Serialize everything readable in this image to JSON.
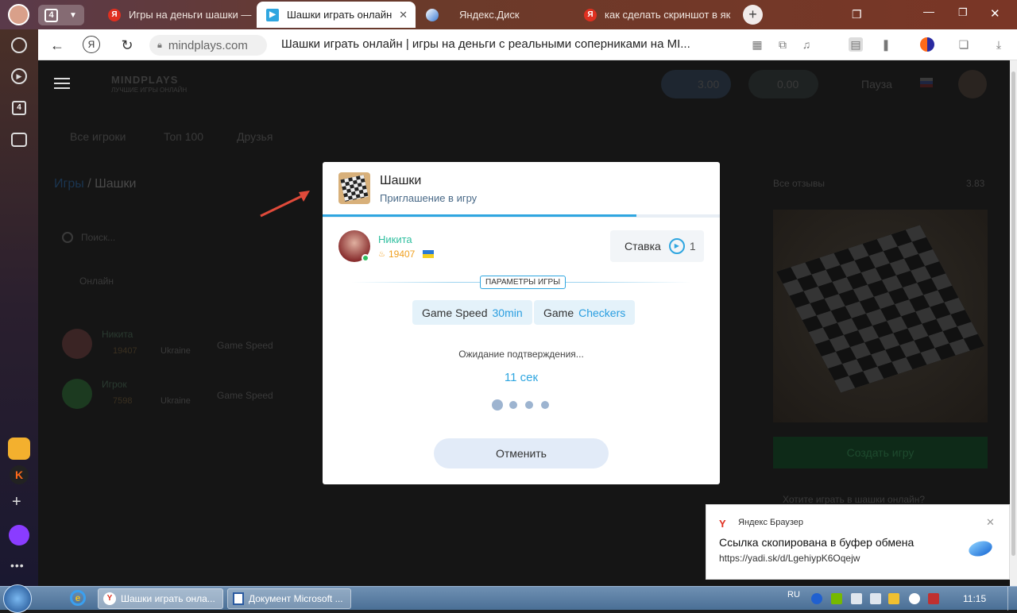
{
  "browser": {
    "tab_count": "4",
    "tabs": [
      {
        "title": "Игры на деньги шашки —",
        "fav": "Я"
      },
      {
        "title": "Шашки играть онлайн",
        "fav": "▶"
      },
      {
        "title": "Яндекс.Диск",
        "fav": ""
      },
      {
        "title": "как сделать скриншот в як",
        "fav": "Я"
      }
    ],
    "address": "mindplays.com",
    "page_title": "Шашки играть онлайн | игры на деньги с реальными соперниками на MI..."
  },
  "background_page": {
    "brand": "MINDPLAYS",
    "brand_sub": "ЛУЧШИЕ ИГРЫ ОНЛАЙН",
    "balance_1": "3.00",
    "balance_2": "0.00",
    "pause": "Пауза",
    "tabs": [
      "Все игроки",
      "Топ 100",
      "Друзья"
    ],
    "breadcrumb_link": "Игры",
    "breadcrumb_current": "/ Шашки",
    "search_placeholder": "Поиск...",
    "online": "Онлайн",
    "reviews_label": "Все отзывы",
    "reviews_score": "3.83",
    "create_game": "Создать игру",
    "faq": "Хотите играть в шашки онлайн?",
    "rows": [
      {
        "name": "Никита",
        "rating": "19407",
        "country": "Ukraine",
        "label": "Game Speed"
      },
      {
        "name": "Игрок",
        "rating": "7598",
        "country": "Ukraine",
        "label": "Game Speed"
      }
    ]
  },
  "modal": {
    "game": "Шашки",
    "subtitle": "Приглашение в игру",
    "player_name": "Никита",
    "player_rating": "19407",
    "stake_label": "Ставка",
    "stake_value": "1",
    "params_label": "ПАРАМЕТРЫ ИГРЫ",
    "speed_label": "Game Speed",
    "speed_value": "30min",
    "game_label": "Game",
    "game_value": "Checkers",
    "waiting": "Ожидание подтверждения...",
    "timer": "11 сек",
    "cancel": "Отменить"
  },
  "notification": {
    "app": "Яндекс Браузер",
    "title": "Ссылка скопирована в буфер обмена",
    "url": "https://yadi.sk/d/LgehiypK6Oqejw"
  },
  "taskbar": {
    "tasks": [
      "Шашки играть онла...",
      "Документ Microsoft ..."
    ],
    "lang": "RU",
    "time": "11:15"
  },
  "colors": {
    "accent": "#2fa6e0",
    "player_green": "#2fbf9f",
    "rating_orange": "#f0a020"
  }
}
